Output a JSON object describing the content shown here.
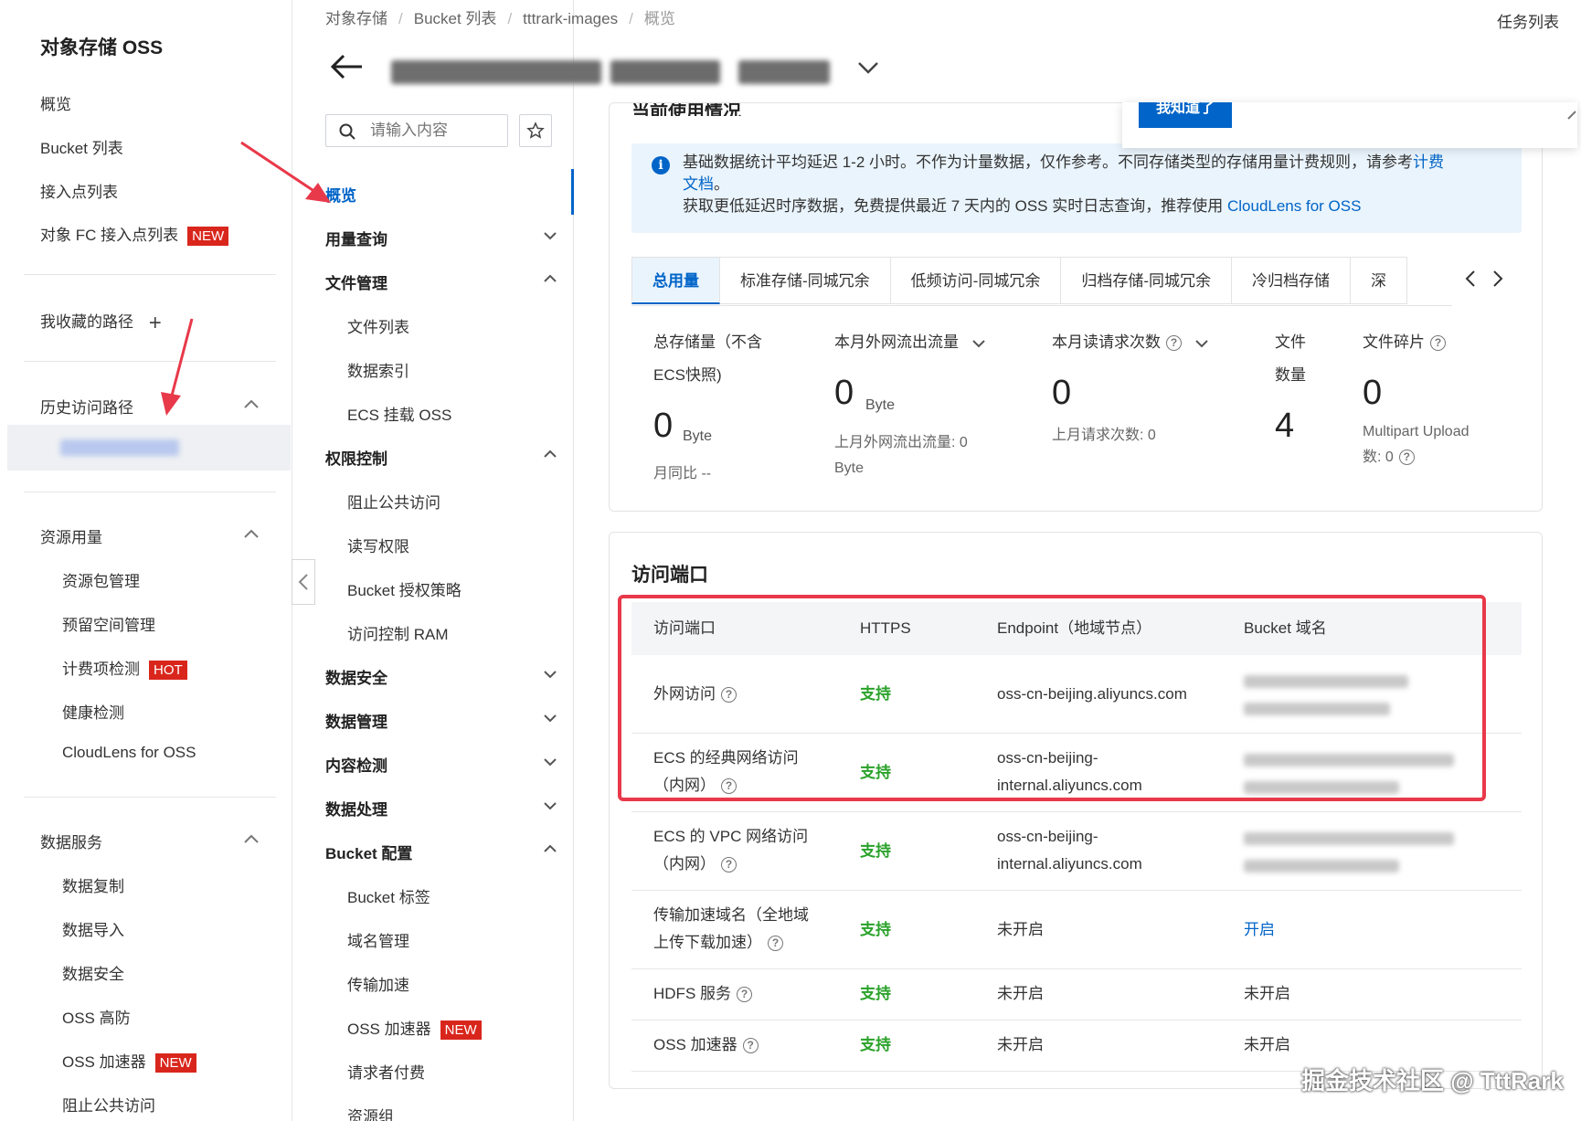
{
  "sidebar": {
    "title": "对象存储 OSS",
    "items": [
      {
        "label": "概览"
      },
      {
        "label": "Bucket 列表"
      },
      {
        "label": "接入点列表"
      },
      {
        "label": "对象 FC 接入点列表",
        "badge": "NEW"
      }
    ],
    "favorites_label": "我收藏的路径",
    "history_label": "历史访问路径",
    "resource_usage": {
      "label": "资源用量",
      "items": [
        {
          "label": "资源包管理"
        },
        {
          "label": "预留空间管理"
        },
        {
          "label": "计费项检测",
          "badge": "HOT"
        },
        {
          "label": "健康检测"
        },
        {
          "label": "CloudLens for OSS"
        }
      ]
    },
    "data_services": {
      "label": "数据服务",
      "items": [
        {
          "label": "数据复制"
        },
        {
          "label": "数据导入"
        },
        {
          "label": "数据安全"
        },
        {
          "label": "OSS 高防"
        },
        {
          "label": "OSS 加速器",
          "badge": "NEW"
        },
        {
          "label": "阻止公共访问"
        }
      ]
    }
  },
  "breadcrumb": [
    "对象存储",
    "Bucket 列表",
    "tttrark-images",
    "概览"
  ],
  "task_list_label": "任务列表",
  "midmenu": {
    "search_placeholder": "请输入内容",
    "overview": "概览",
    "usage_query": "用量查询",
    "file_mgmt": {
      "label": "文件管理",
      "items": [
        "文件列表",
        "数据索引",
        "ECS 挂载 OSS"
      ]
    },
    "access_control": {
      "label": "权限控制",
      "items": [
        "阻止公共访问",
        "读写权限",
        "Bucket 授权策略",
        "访问控制 RAM"
      ]
    },
    "data_security": "数据安全",
    "data_mgmt": "数据管理",
    "content_detect": "内容检测",
    "data_process": "数据处理",
    "bucket_config": {
      "label": "Bucket 配置",
      "items": [
        "Bucket 标签",
        "域名管理",
        "传输加速",
        "OSS 加速器",
        "请求者付费",
        "资源组"
      ],
      "new_badge": "NEW"
    }
  },
  "usage": {
    "section_title": "当前使用情况",
    "known_button": "我知道了",
    "info_line1_prefix": "基础数据统计平均延迟 1-2 小时。不作为计量数据，仅作参考。不同存储类型的存储用量计费规则，请参考",
    "info_line1_link": "计费",
    "info_line2_link": "文档",
    "info_line2_suffix": "。",
    "info_line3_prefix": "获取更低延迟时序数据，免费提供最近 7 天内的 OSS 实时日志查询，推荐使用",
    "info_line3_link": "CloudLens for OSS",
    "tabs": [
      "总用量",
      "标准存储-同城冗余",
      "低频访问-同城冗余",
      "归档存储-同城冗余",
      "冷归档存储",
      "深"
    ],
    "metrics": {
      "storage": {
        "label_line1": "总存储量（不含",
        "label_line2": "ECS快照)",
        "value": "0",
        "unit": "Byte",
        "sub": "月同比 --"
      },
      "traffic": {
        "label": "本月外网流出流量",
        "value": "0",
        "unit": "Byte",
        "sub_line1": "上月外网流出流量:  0",
        "sub_line2": "Byte"
      },
      "requests": {
        "label": "本月读请求次数",
        "value": "0",
        "sub": "上月请求次数:   0"
      },
      "files": {
        "label_line1": "文件",
        "label_line2": "数量",
        "value": "4"
      },
      "fragments": {
        "label": "文件碎片",
        "value": "0",
        "sub_line1": "Multipart Upload",
        "sub_line2": "数:  0"
      }
    }
  },
  "endpoint": {
    "title": "访问端口",
    "headers": [
      "访问端口",
      "HTTPS",
      "Endpoint（地域节点）",
      "Bucket 域名"
    ],
    "rows": [
      {
        "name": [
          "外网访问"
        ],
        "https": "支持",
        "endpoint": [
          "oss-cn-beijing.aliyuncs.com"
        ],
        "domain": ""
      },
      {
        "name": [
          "ECS 的经典网络访问",
          "（内网）"
        ],
        "https": "支持",
        "endpoint": [
          "oss-cn-beijing-",
          "internal.aliyuncs.com"
        ],
        "domain": ""
      },
      {
        "name": [
          "ECS 的 VPC 网络访问",
          "（内网）"
        ],
        "https": "支持",
        "endpoint": [
          "oss-cn-beijing-",
          "internal.aliyuncs.com"
        ],
        "domain": ""
      },
      {
        "name": [
          "传输加速域名（全地域",
          "上传下载加速）"
        ],
        "https": "支持",
        "endpoint": [
          "未开启"
        ],
        "domain": "开启"
      },
      {
        "name": [
          "HDFS 服务"
        ],
        "https": "支持",
        "endpoint": [
          "未开启"
        ],
        "domain": "未开启"
      },
      {
        "name": [
          "OSS 加速器"
        ],
        "https": "支持",
        "endpoint": [
          "未开启"
        ],
        "domain": "未开启"
      }
    ]
  },
  "watermark": "掘金技术社区 @ TttRark",
  "colors": {
    "brand": "#0064c8",
    "support": "#2aa22a",
    "badge": "#d9261c",
    "annotation": "#e8394a"
  }
}
